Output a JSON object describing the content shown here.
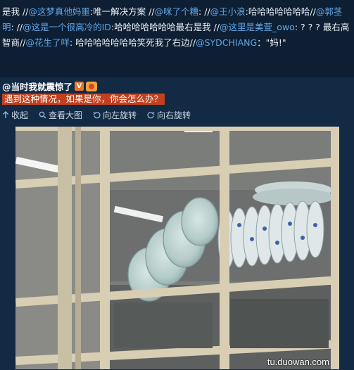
{
  "post": {
    "segments": [
      {
        "t": "plain",
        "v": "是我 //"
      },
      {
        "t": "mention",
        "v": "@这梦真他妈噩"
      },
      {
        "t": "plain",
        "v": ":唯一解决方案 //"
      },
      {
        "t": "mention",
        "v": "@咪了个糟"
      },
      {
        "t": "plain",
        "v": ": //"
      },
      {
        "t": "mention",
        "v": "@王小浪"
      },
      {
        "t": "plain",
        "v": ":哈哈哈哈哈哈哈//"
      },
      {
        "t": "mention",
        "v": "@郭茎明"
      },
      {
        "t": "plain",
        "v": ": //"
      },
      {
        "t": "mention",
        "v": "@这是一个很高冷的ID"
      },
      {
        "t": "plain",
        "v": ":哈哈哈哈哈哈哈最右是我 //"
      },
      {
        "t": "mention",
        "v": "@这里是美萱_owo"
      },
      {
        "t": "plain",
        "v": ": ? ? ? 最右高智商//"
      },
      {
        "t": "mention",
        "v": "@花生了咩"
      },
      {
        "t": "plain",
        "v": ": 哈哈哈哈哈哈哈笑死我了右边//"
      },
      {
        "t": "mention",
        "v": "@SYDCHIANG"
      },
      {
        "t": "plain",
        "v": "：\"妈!\""
      }
    ]
  },
  "repost": {
    "author": "@当时我就震惊了",
    "v_badge": "V",
    "question": "遇到这种情况，如果是你，你会怎么办？",
    "toolbar": {
      "collapse": "收起",
      "view_large": "查看大图",
      "rotate_left": "向左旋转",
      "rotate_right": "向右旋转"
    }
  },
  "watermark": "tu.duowan.com",
  "icons": {
    "collapse": "collapse-up-arrow-icon",
    "view_large": "magnifier-icon",
    "rotate_left": "rotate-left-icon",
    "rotate_right": "rotate-right-icon"
  },
  "colors": {
    "background": "#0f2035",
    "mention": "#5fa6e8",
    "question_highlight": "#c2401e",
    "v_badge": "#e8762b"
  }
}
